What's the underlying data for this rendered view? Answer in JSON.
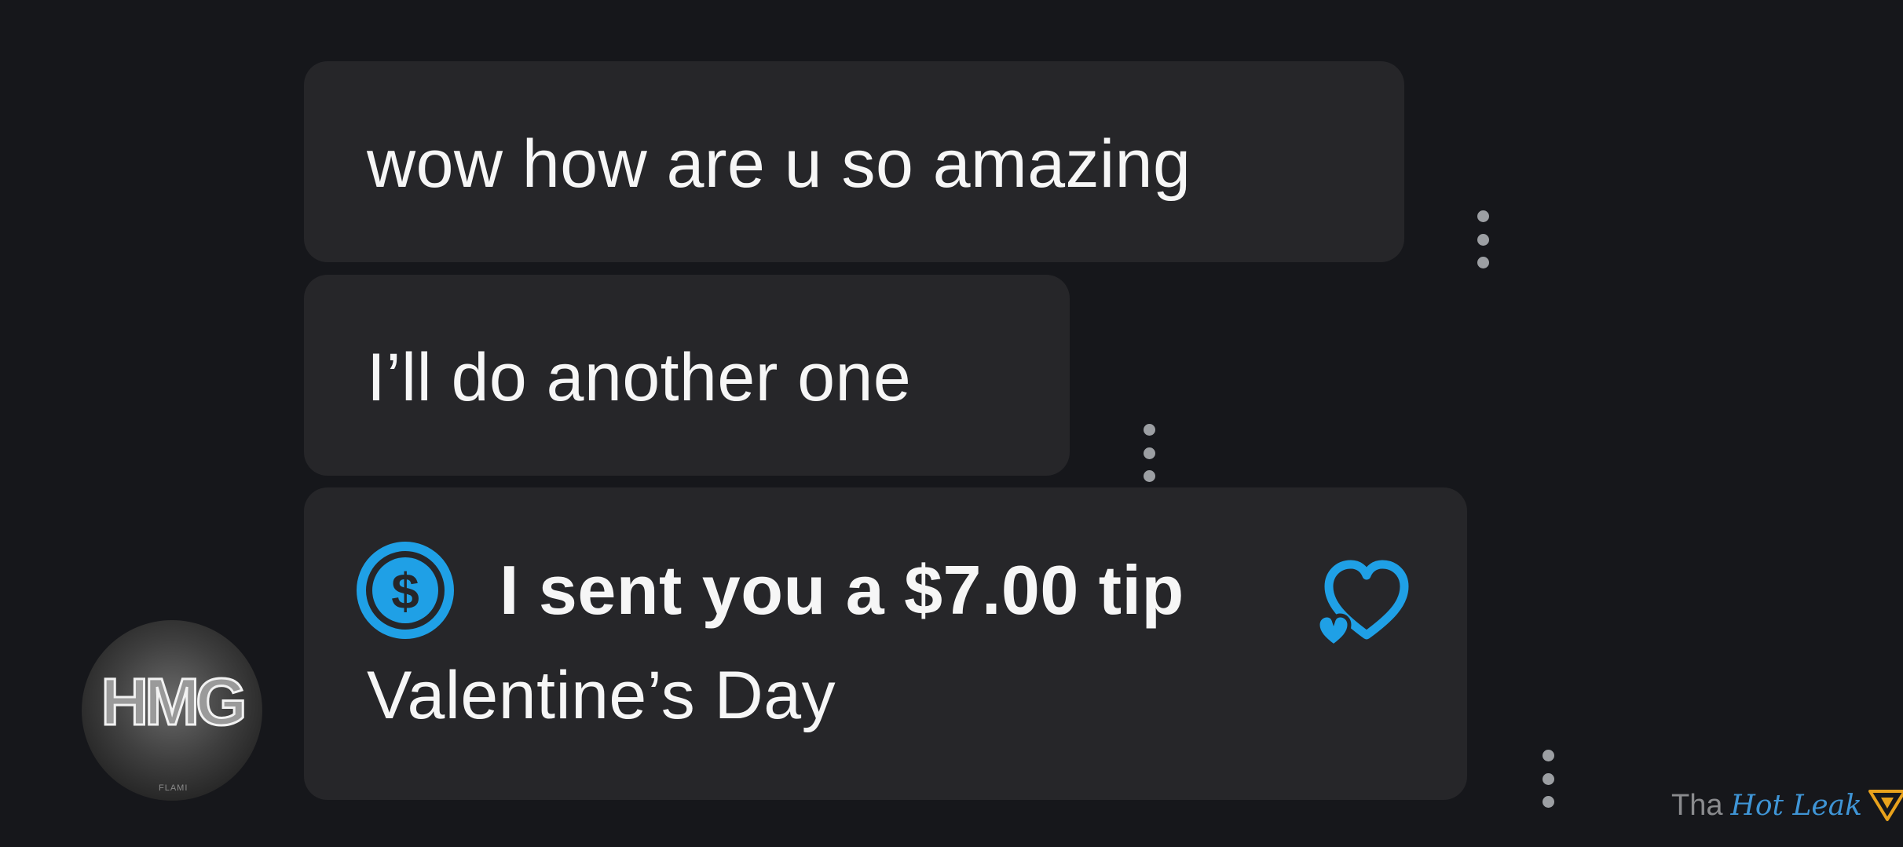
{
  "messages": [
    {
      "text": "wow how are u so amazing"
    },
    {
      "text": "I’ll do another one"
    },
    {
      "tip_text": "I sent you a $7.00 tip",
      "note": "Valentine’s Day"
    }
  ],
  "avatar": {
    "logo_text": "HMG",
    "caption": "FLAMI"
  },
  "watermark": {
    "text": "Tha",
    "script_text": "Hot Leak"
  },
  "colors": {
    "background": "#16171b",
    "bubble": "#262629",
    "accent": "#1fa0e6",
    "text": "#f6f6f6"
  },
  "icons": [
    "dollar-circle-icon",
    "hearts-icon",
    "more-vertical-icon"
  ]
}
